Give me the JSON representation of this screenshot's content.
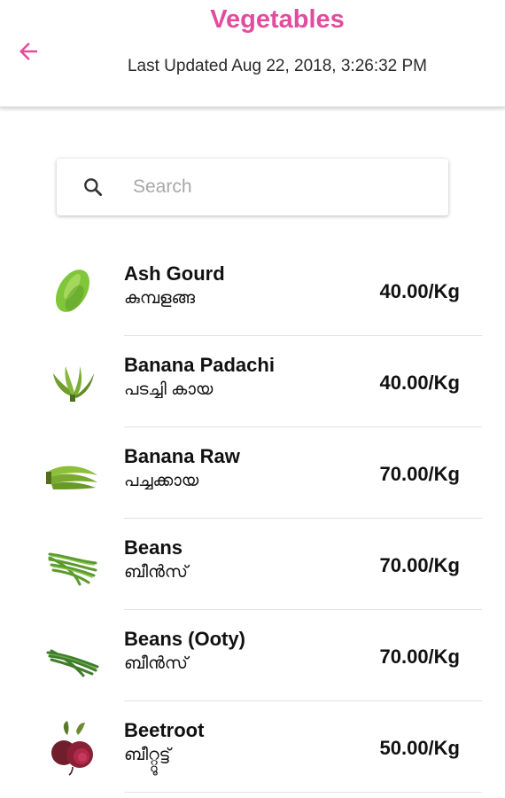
{
  "header": {
    "title": "Vegetables",
    "subtitle": "Last Updated Aug 22, 2018, 3:26:32 PM",
    "back_icon": "arrow-left-icon",
    "accent_color": "#e24c9c"
  },
  "search": {
    "placeholder": "Search",
    "value": "",
    "icon": "search-icon"
  },
  "items": [
    {
      "name": "Ash Gourd",
      "local_name": "കുമ്പളങ്ങ",
      "price": "40.00/Kg",
      "icon": "ash-gourd-icon"
    },
    {
      "name": "Banana Padachi",
      "local_name": "പടച്ചി കായ",
      "price": "40.00/Kg",
      "icon": "banana-padachi-icon"
    },
    {
      "name": "Banana Raw",
      "local_name": "പച്ചക്കായ",
      "price": "70.00/Kg",
      "icon": "banana-raw-icon"
    },
    {
      "name": "Beans",
      "local_name": "ബീൻസ്",
      "price": "70.00/Kg",
      "icon": "beans-icon"
    },
    {
      "name": "Beans (Ooty)",
      "local_name": "ബീൻസ്",
      "price": "70.00/Kg",
      "icon": "beans-ooty-icon"
    },
    {
      "name": "Beetroot",
      "local_name": "ബീറ്റ്റൂട്ട്",
      "price": "50.00/Kg",
      "icon": "beetroot-icon"
    }
  ]
}
